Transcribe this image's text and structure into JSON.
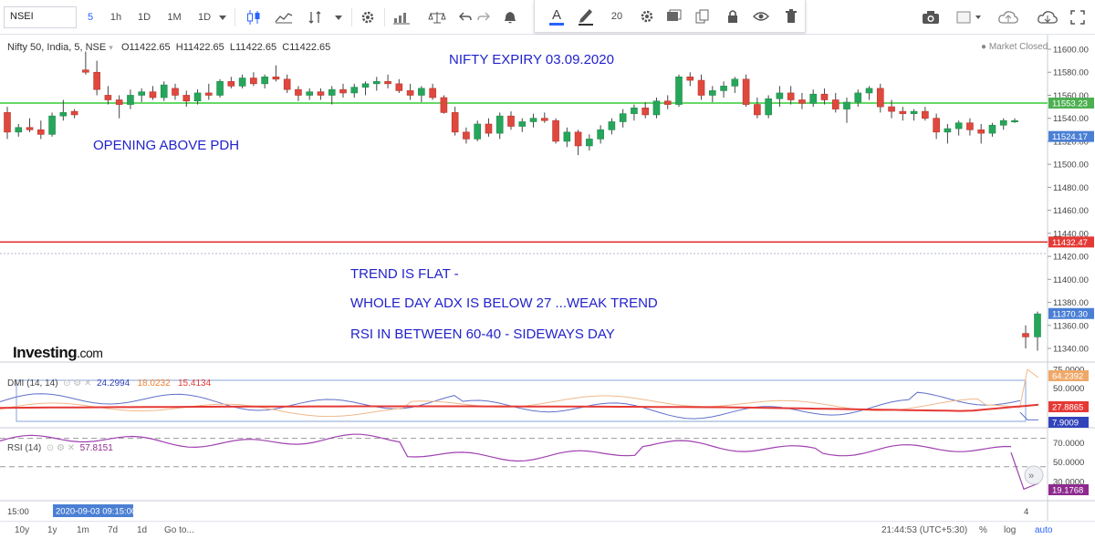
{
  "toolbar": {
    "symbol": "NSEI",
    "intervals": [
      "5",
      "1h",
      "1D",
      "1M",
      "1D"
    ],
    "float_font_size": "20"
  },
  "chart": {
    "legend_symbol": "Nifty 50, India, 5, NSE",
    "open_label": "O",
    "open": "11422.65",
    "high_label": "H",
    "high": "11422.65",
    "low_label": "L",
    "low": "11422.65",
    "close_label": "C",
    "close": "11422.65",
    "market_status": "Market Closed",
    "logo_main": "Investing",
    "logo_suffix": ".com"
  },
  "annotations": {
    "expiry": "NIFTY EXPIRY 03.09.2020",
    "opening": "OPENING ABOVE PDH",
    "trend": "TREND IS FLAT -",
    "adx": "WHOLE DAY ADX IS BELOW 27 ...WEAK TREND",
    "rsi": "RSI IN BETWEEN 60-40 - SIDEWAYS DAY"
  },
  "dmi": {
    "label": "DMI (14, 14)",
    "v1": "24.2994",
    "v2": "18.0232",
    "v3": "15.4134"
  },
  "rsi": {
    "label": "RSI (14)",
    "value": "57.8151"
  },
  "price_axis": {
    "ticks": [
      "11600.00",
      "11580.00",
      "11560.00",
      "11540.00",
      "11520.00",
      "11500.00",
      "11480.00",
      "11460.00",
      "11440.00",
      "11420.00",
      "11400.00",
      "11380.00",
      "11360.00",
      "11340.00"
    ],
    "badges": [
      {
        "text": "11553.23",
        "color": "#4caf50",
        "value": 11553.23
      },
      {
        "text": "11524.17",
        "color": "#4a7fd4",
        "value": 11524.17
      },
      {
        "text": "11432.47",
        "color": "#e53935",
        "value": 11432.47
      },
      {
        "text": "11370.30",
        "color": "#4a7fd4",
        "value": 11370.3
      }
    ]
  },
  "dmi_axis": {
    "ticks": [
      "75.0000",
      "50.0000",
      "25.0000"
    ],
    "badges": [
      {
        "text": "64.2392",
        "color": "#f0a868"
      },
      {
        "text": "27.8865",
        "color": "#e53935"
      },
      {
        "text": "7.9009",
        "color": "#3344bb"
      }
    ]
  },
  "rsi_axis": {
    "ticks": [
      "70.0000",
      "50.0000",
      "30.0000"
    ],
    "badges": [
      {
        "text": "19.1768",
        "color": "#8e2a8e"
      }
    ]
  },
  "time_axis": {
    "left_label": "15:00",
    "cursor_label": "2020-09-03 09:15:00",
    "right_label": "4"
  },
  "bottom_bar": {
    "ranges": [
      "10y",
      "1y",
      "1m",
      "7d",
      "1d"
    ],
    "goto": "Go to...",
    "clock": "21:44:53 (UTC+5:30)",
    "percent": "%",
    "log": "log",
    "auto": "auto"
  },
  "chart_data": {
    "type": "candlestick",
    "title": "Nifty 50, India, 5, NSE",
    "ylim": [
      11330,
      11610
    ],
    "horizontal_lines": [
      {
        "value": 11553.23,
        "color": "#33cc33"
      },
      {
        "value": 11432.47,
        "color": "#dd2222"
      }
    ],
    "candles": [
      [
        11545,
        11550,
        11522,
        11528
      ],
      [
        11528,
        11535,
        11524,
        11532
      ],
      [
        11532,
        11540,
        11528,
        11530
      ],
      [
        11530,
        11538,
        11522,
        11526
      ],
      [
        11526,
        11545,
        11524,
        11542
      ],
      [
        11542,
        11556,
        11538,
        11545
      ],
      [
        11546,
        11548,
        11540,
        11543
      ],
      [
        11582,
        11598,
        11578,
        11580
      ],
      [
        11580,
        11590,
        11560,
        11565
      ],
      [
        11560,
        11568,
        11552,
        11556
      ],
      [
        11556,
        11560,
        11540,
        11552
      ],
      [
        11552,
        11565,
        11548,
        11560
      ],
      [
        11560,
        11566,
        11554,
        11563
      ],
      [
        11563,
        11568,
        11556,
        11558
      ],
      [
        11558,
        11572,
        11555,
        11569
      ],
      [
        11566,
        11570,
        11556,
        11560
      ],
      [
        11560,
        11564,
        11550,
        11555
      ],
      [
        11555,
        11565,
        11552,
        11562
      ],
      [
        11562,
        11570,
        11556,
        11560
      ],
      [
        11560,
        11574,
        11558,
        11572
      ],
      [
        11572,
        11576,
        11566,
        11568
      ],
      [
        11568,
        11578,
        11566,
        11575
      ],
      [
        11575,
        11580,
        11568,
        11570
      ],
      [
        11570,
        11578,
        11566,
        11576
      ],
      [
        11576,
        11586,
        11572,
        11574
      ],
      [
        11574,
        11578,
        11562,
        11565
      ],
      [
        11565,
        11568,
        11555,
        11560
      ],
      [
        11560,
        11566,
        11556,
        11563
      ],
      [
        11563,
        11566,
        11556,
        11560
      ],
      [
        11560,
        11568,
        11552,
        11565
      ],
      [
        11565,
        11570,
        11558,
        11562
      ],
      [
        11562,
        11570,
        11558,
        11567
      ],
      [
        11567,
        11572,
        11560,
        11570
      ],
      [
        11570,
        11576,
        11564,
        11572
      ],
      [
        11572,
        11578,
        11566,
        11570
      ],
      [
        11570,
        11574,
        11562,
        11564
      ],
      [
        11564,
        11570,
        11556,
        11560
      ],
      [
        11560,
        11568,
        11554,
        11566
      ],
      [
        11566,
        11570,
        11556,
        11558
      ],
      [
        11558,
        11560,
        11544,
        11545
      ],
      [
        11545,
        11550,
        11525,
        11528
      ],
      [
        11528,
        11532,
        11518,
        11522
      ],
      [
        11522,
        11538,
        11520,
        11535
      ],
      [
        11535,
        11540,
        11524,
        11527
      ],
      [
        11527,
        11545,
        11522,
        11542
      ],
      [
        11542,
        11546,
        11530,
        11533
      ],
      [
        11533,
        11540,
        11528,
        11537
      ],
      [
        11537,
        11544,
        11532,
        11540
      ],
      [
        11540,
        11545,
        11536,
        11538
      ],
      [
        11538,
        11540,
        11518,
        11520
      ],
      [
        11520,
        11532,
        11515,
        11528
      ],
      [
        11528,
        11530,
        11508,
        11516
      ],
      [
        11516,
        11526,
        11512,
        11522
      ],
      [
        11522,
        11534,
        11518,
        11530
      ],
      [
        11530,
        11540,
        11526,
        11537
      ],
      [
        11537,
        11548,
        11532,
        11544
      ],
      [
        11544,
        11552,
        11538,
        11549
      ],
      [
        11549,
        11554,
        11540,
        11543
      ],
      [
        11543,
        11558,
        11540,
        11555
      ],
      [
        11555,
        11560,
        11548,
        11552
      ],
      [
        11552,
        11578,
        11550,
        11576
      ],
      [
        11576,
        11580,
        11568,
        11573
      ],
      [
        11573,
        11578,
        11556,
        11560
      ],
      [
        11560,
        11568,
        11554,
        11564
      ],
      [
        11564,
        11572,
        11558,
        11568
      ],
      [
        11568,
        11576,
        11562,
        11574
      ],
      [
        11574,
        11578,
        11550,
        11552
      ],
      [
        11552,
        11558,
        11540,
        11543
      ],
      [
        11543,
        11560,
        11540,
        11557
      ],
      [
        11557,
        11568,
        11550,
        11562
      ],
      [
        11562,
        11568,
        11552,
        11556
      ],
      [
        11556,
        11562,
        11548,
        11553
      ],
      [
        11553,
        11565,
        11550,
        11561
      ],
      [
        11561,
        11566,
        11552,
        11556
      ],
      [
        11556,
        11562,
        11545,
        11548
      ],
      [
        11548,
        11558,
        11536,
        11554
      ],
      [
        11554,
        11565,
        11550,
        11562
      ],
      [
        11562,
        11568,
        11556,
        11566
      ],
      [
        11566,
        11570,
        11545,
        11550
      ],
      [
        11550,
        11556,
        11540,
        11546
      ],
      [
        11546,
        11550,
        11538,
        11544
      ],
      [
        11544,
        11548,
        11538,
        11546
      ],
      [
        11546,
        11550,
        11538,
        11540
      ],
      [
        11540,
        11544,
        11522,
        11528
      ],
      [
        11528,
        11535,
        11518,
        11531
      ],
      [
        11531,
        11538,
        11525,
        11536
      ],
      [
        11536,
        11540,
        11525,
        11530
      ],
      [
        11530,
        11535,
        11518,
        11527
      ],
      [
        11527,
        11536,
        11524,
        11534
      ],
      [
        11534,
        11540,
        11530,
        11538
      ],
      [
        11538,
        11540,
        11536,
        11538
      ],
      [
        11353,
        11360,
        11340,
        11350
      ],
      [
        11350,
        11372,
        11338,
        11370
      ]
    ]
  }
}
